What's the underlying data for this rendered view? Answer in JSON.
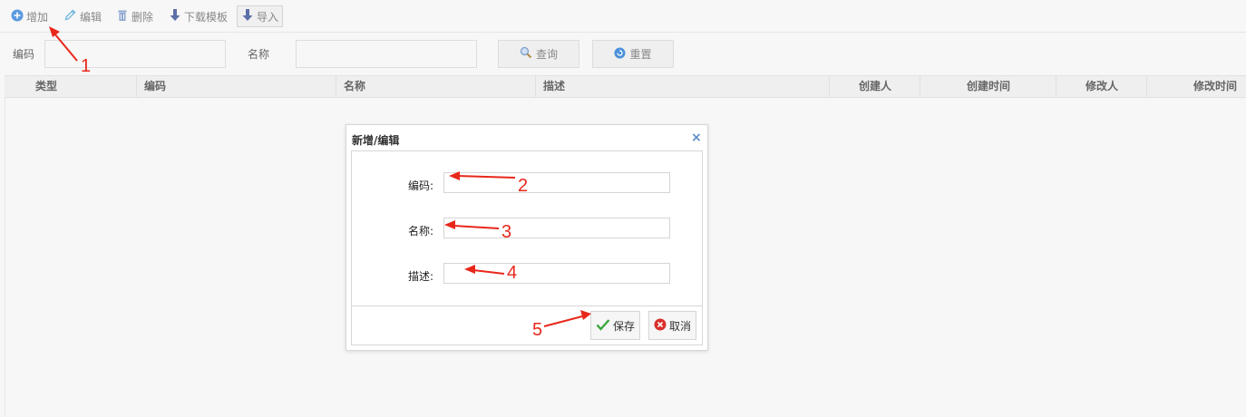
{
  "toolbar": {
    "add_label": "增加",
    "edit_label": "编辑",
    "delete_label": "删除",
    "download_template_label": "下载模板",
    "import_label": "导入"
  },
  "search": {
    "code_label": "编码",
    "name_label": "名称",
    "code_value": "",
    "name_value": "",
    "query_label": "查询",
    "reset_label": "重置"
  },
  "grid": {
    "columns": [
      "类型",
      "编码",
      "名称",
      "描述",
      "创建人",
      "创建时间",
      "修改人",
      "修改时间"
    ]
  },
  "dialog": {
    "title": "新增/编辑",
    "close": "×",
    "code_label": "编码:",
    "name_label": "名称:",
    "desc_label": "描述:",
    "code_value": "",
    "name_value": "",
    "desc_value": "",
    "save_label": "保存",
    "cancel_label": "取消"
  },
  "annotations": [
    "1",
    "2",
    "3",
    "4",
    "5"
  ],
  "colors": {
    "annotation": "#e8271b",
    "add_icon": "#5b9ae0",
    "save_check": "#3aa73a",
    "cancel_icon": "#d9302c",
    "toolbar_arrow": "#5d6fa8"
  }
}
